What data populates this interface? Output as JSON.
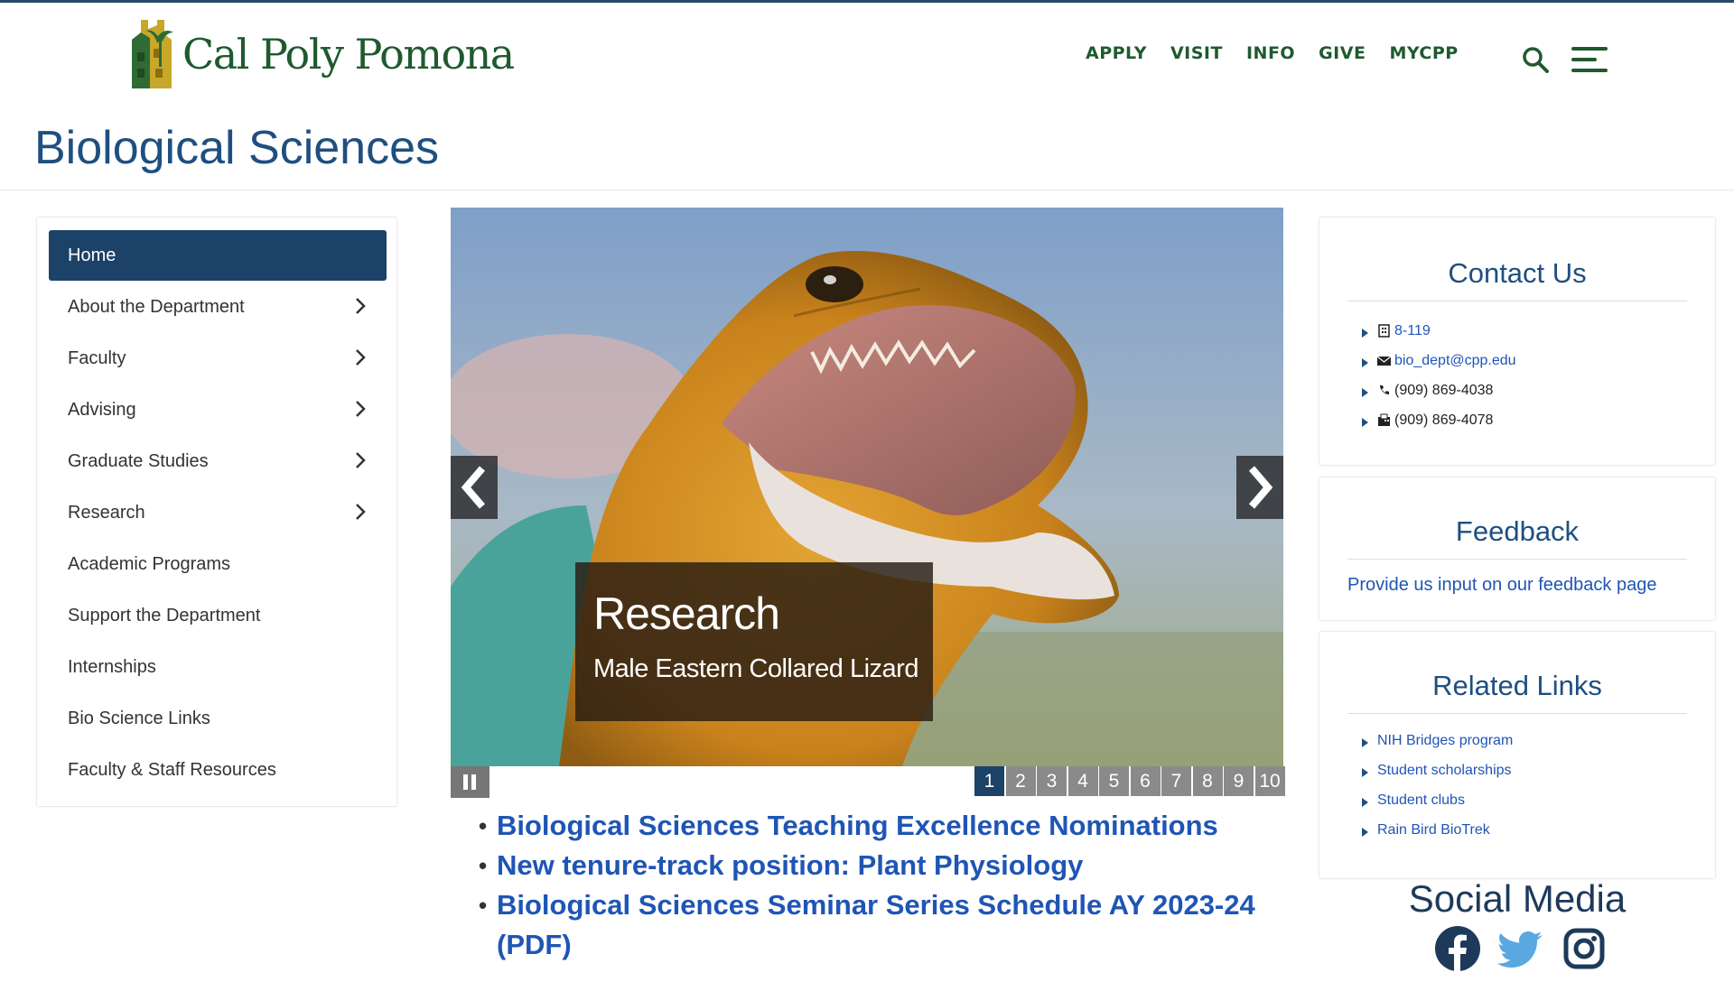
{
  "header": {
    "logo_text": "Cal Poly Pomona",
    "nav": [
      "APPLY",
      "VISIT",
      "INFO",
      "GIVE",
      "MYCPP"
    ],
    "search_icon": "search-icon",
    "menu_icon": "hamburger-menu-icon",
    "brand_color": "#1f5a2f",
    "accent_color": "#1e4f80"
  },
  "page": {
    "title": "Biological Sciences"
  },
  "sidebar": {
    "items": [
      {
        "label": "Home",
        "active": true,
        "has_submenu": false
      },
      {
        "label": "About the Department",
        "has_submenu": true
      },
      {
        "label": "Faculty",
        "has_submenu": true
      },
      {
        "label": "Advising",
        "has_submenu": true
      },
      {
        "label": "Graduate Studies",
        "has_submenu": true
      },
      {
        "label": "Research",
        "has_submenu": true
      },
      {
        "label": "Academic Programs",
        "has_submenu": false
      },
      {
        "label": "Support the Department",
        "has_submenu": false
      },
      {
        "label": "Internships",
        "has_submenu": false
      },
      {
        "label": "Bio Science Links",
        "has_submenu": false
      },
      {
        "label": "Faculty & Staff Resources",
        "has_submenu": false
      }
    ]
  },
  "carousel": {
    "caption_title": "Research",
    "caption_subtitle": "Male Eastern Collared Lizard",
    "pages": [
      "1",
      "2",
      "3",
      "4",
      "5",
      "6",
      "7",
      "8",
      "9",
      "10"
    ],
    "current_page": "1"
  },
  "news": [
    "Biological Sciences Teaching Excellence Nominations",
    "New tenure-track position: Plant Physiology",
    "Biological Sciences Seminar Series Schedule AY 2023-24 (PDF)"
  ],
  "contact": {
    "title": "Contact Us",
    "items": [
      {
        "icon": "building-icon",
        "text": "8-119",
        "link": true
      },
      {
        "icon": "envelope-icon",
        "text": "bio_dept@cpp.edu",
        "link": true
      },
      {
        "icon": "phone-icon",
        "text": "(909) 869-4038",
        "link": false
      },
      {
        "icon": "fax-icon",
        "text": "(909) 869-4078",
        "link": false
      }
    ]
  },
  "feedback": {
    "title": "Feedback",
    "link_text": "Provide us input on our feedback page"
  },
  "related": {
    "title": "Related Links",
    "items": [
      "NIH Bridges program",
      "Student scholarships",
      "Student clubs",
      "Rain Bird BioTrek"
    ]
  },
  "social": {
    "title": "Social Media",
    "icons": [
      "facebook-icon",
      "twitter-icon",
      "instagram-icon"
    ]
  }
}
